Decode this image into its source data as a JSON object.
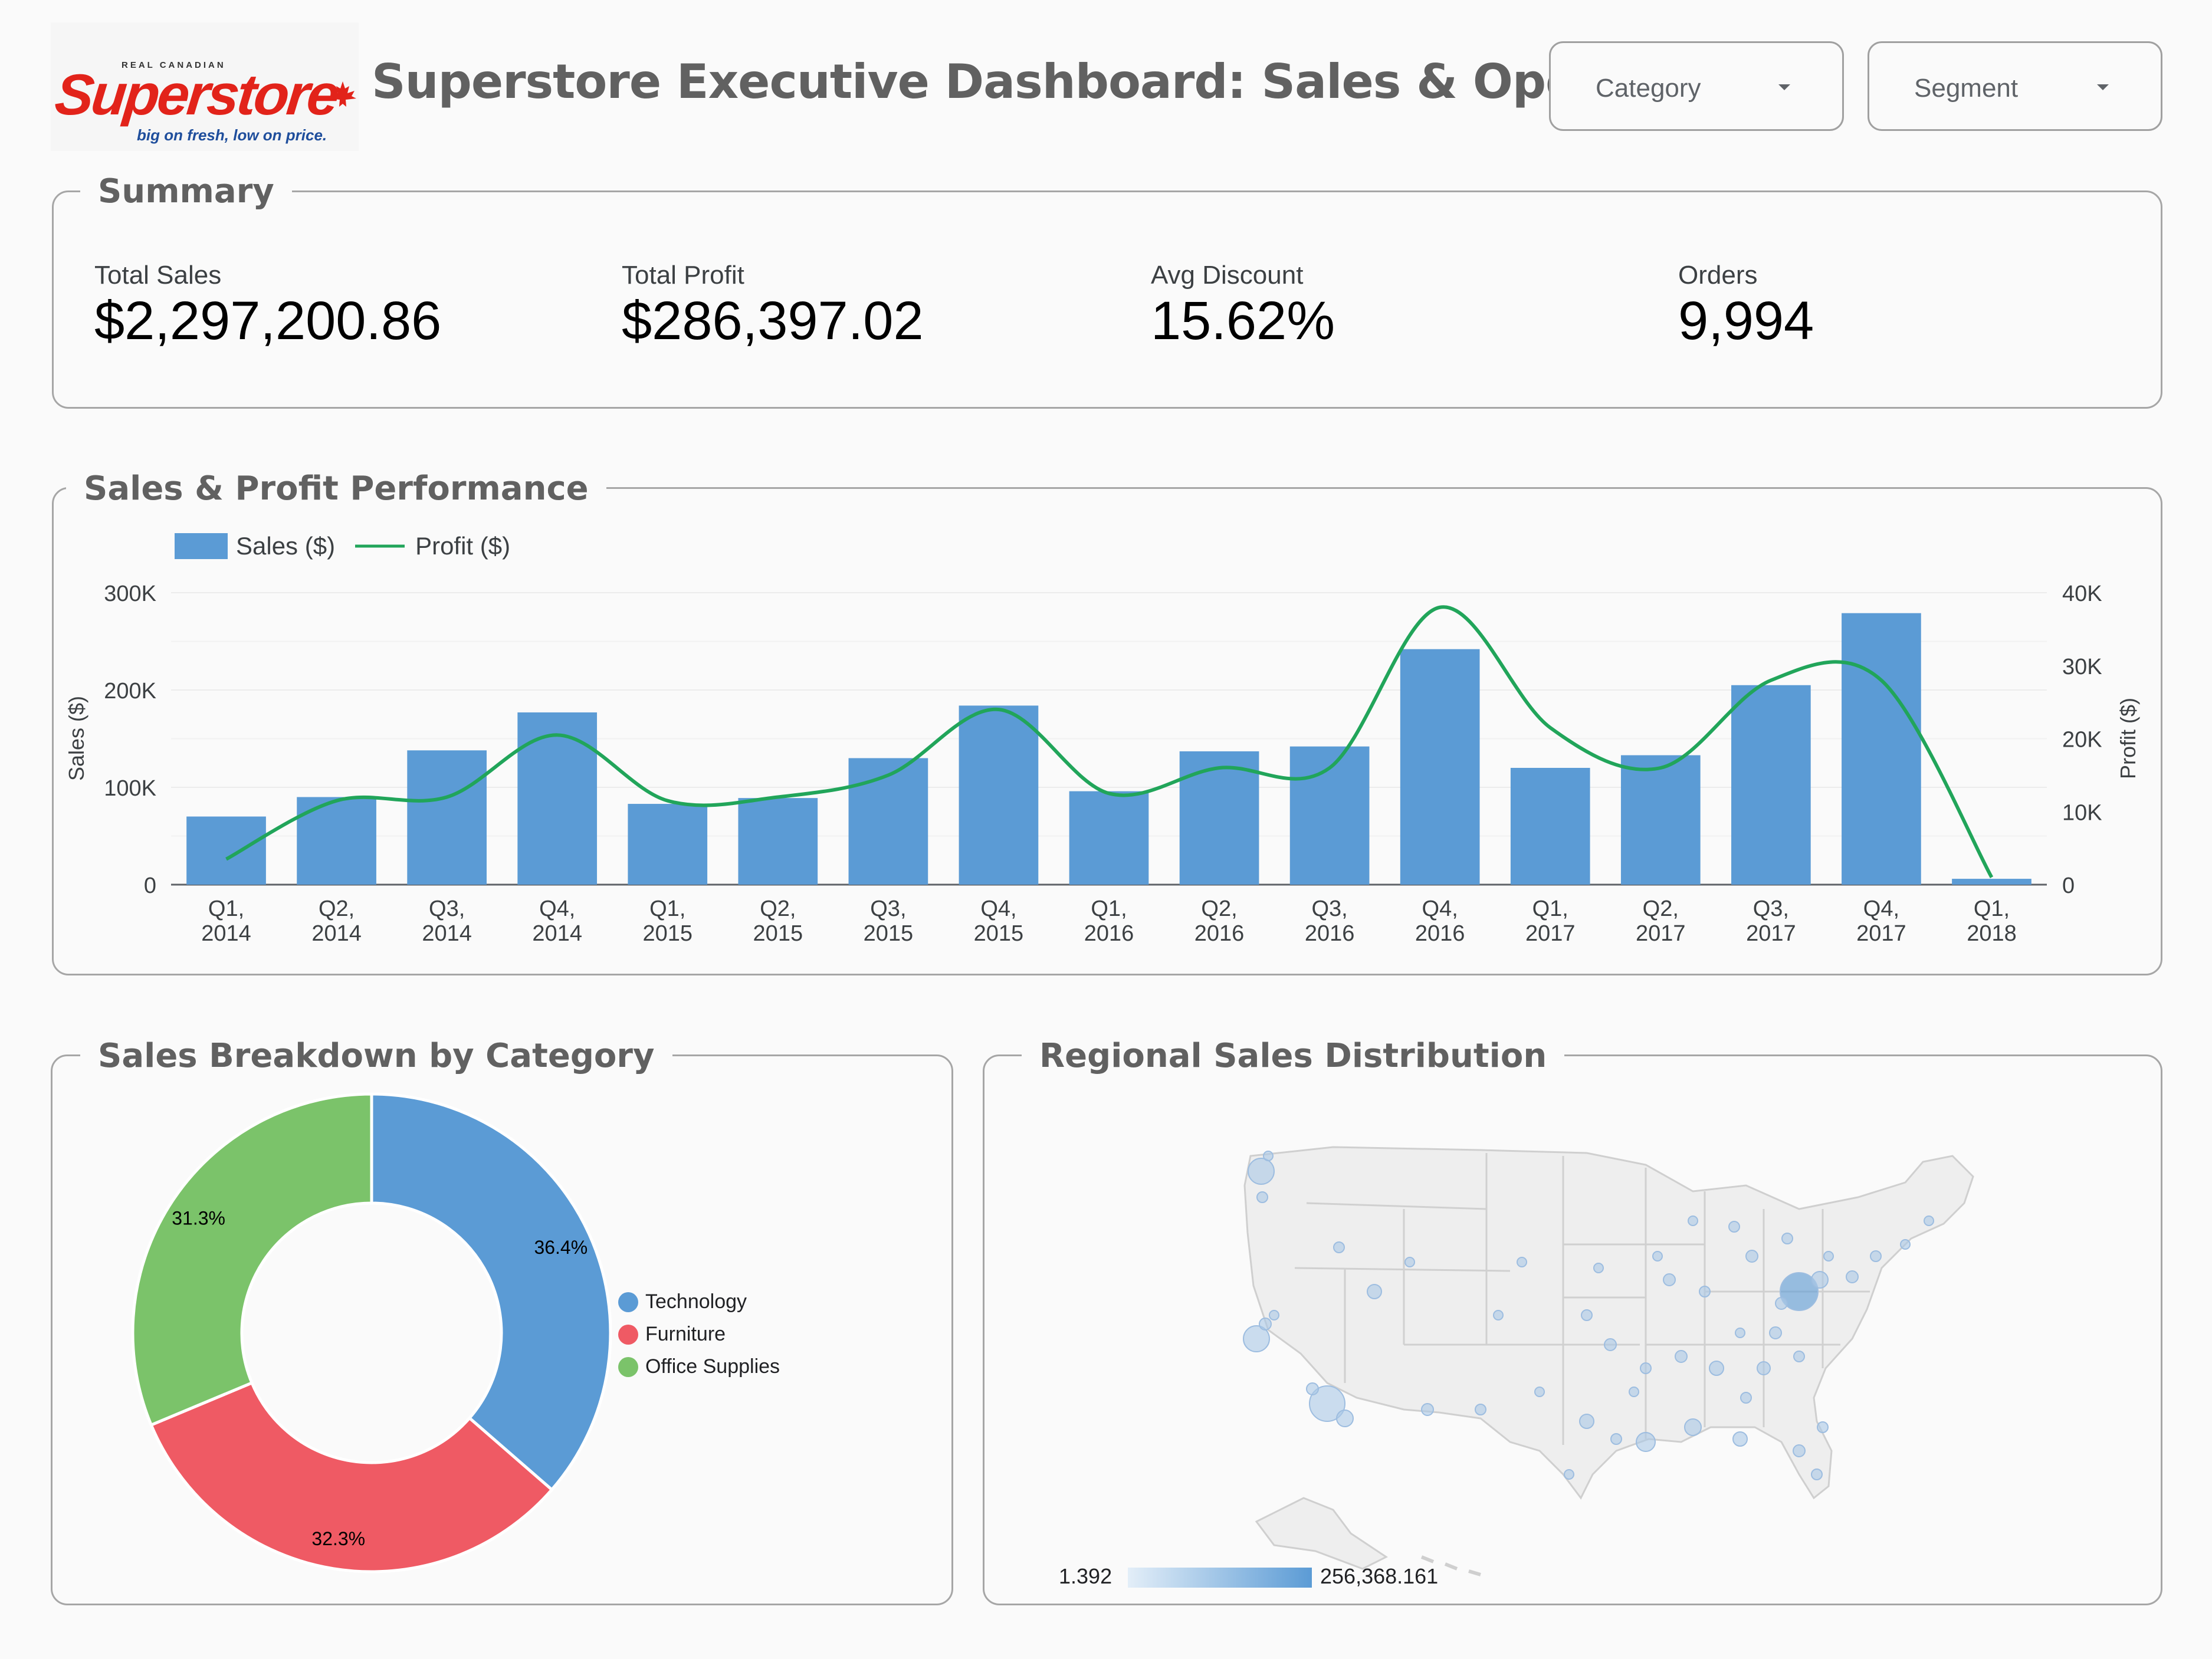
{
  "header": {
    "logo": {
      "top_text": "REAL CANADIAN",
      "brand": "Superstore",
      "tagline": "big on fresh, low on price."
    },
    "title": "Superstore Executive Dashboard: Sales & Operations",
    "filters": [
      {
        "label": "Category",
        "icon": "dropdown-caret-icon"
      },
      {
        "label": "Segment",
        "icon": "dropdown-caret-icon"
      }
    ]
  },
  "summary": {
    "title": "Summary",
    "kpis": [
      {
        "label": "Total Sales",
        "value": "$2,297,200.86"
      },
      {
        "label": "Total Profit",
        "value": "$286,397.02"
      },
      {
        "label": "Avg Discount",
        "value": "15.62%"
      },
      {
        "label": "Orders",
        "value": "9,994"
      }
    ]
  },
  "performance": {
    "title": "Sales & Profit Performance",
    "legend": {
      "sales": "Sales ($)",
      "profit": "Profit ($)"
    }
  },
  "category": {
    "title": "Sales Breakdown by Category"
  },
  "regional": {
    "title": "Regional Sales Distribution",
    "scale_min": "1.392",
    "scale_max": "256,368.161"
  },
  "colors": {
    "bar": "#5b9bd5",
    "profit_line": "#21a55a",
    "technology": "#5b9bd5",
    "furniture": "#ef5a64",
    "office_supplies": "#7bc36a",
    "map_land": "#eeeeee",
    "map_border": "#c8c8c8",
    "bubble": "#aac8e6"
  },
  "chart_data": [
    {
      "type": "bar",
      "title": "Sales & Profit Performance",
      "categories": [
        "Q1,\n2014",
        "Q2,\n2014",
        "Q3,\n2014",
        "Q4,\n2014",
        "Q1,\n2015",
        "Q2,\n2015",
        "Q3,\n2015",
        "Q4,\n2015",
        "Q1,\n2016",
        "Q2,\n2016",
        "Q3,\n2016",
        "Q4,\n2016",
        "Q1,\n2017",
        "Q2,\n2017",
        "Q3,\n2017",
        "Q4,\n2017",
        "Q1,\n2018"
      ],
      "series": [
        {
          "name": "Sales ($)",
          "type": "bar",
          "axis": "left",
          "values": [
            70000,
            90000,
            138000,
            177000,
            83000,
            89000,
            130000,
            184000,
            96000,
            137000,
            142000,
            242000,
            120000,
            133000,
            205000,
            279000,
            6000
          ]
        },
        {
          "name": "Profit ($)",
          "type": "line",
          "axis": "right",
          "values": [
            3500,
            11500,
            12000,
            20500,
            11500,
            12000,
            15000,
            24000,
            12500,
            16000,
            16000,
            38000,
            21500,
            16000,
            28000,
            28000,
            1000
          ]
        }
      ],
      "ylabel": "Sales ($)",
      "y2label": "Profit ($)",
      "ylim": [
        0,
        300000
      ],
      "y2lim": [
        0,
        40000
      ],
      "yticks": [
        "0",
        "100K",
        "200K",
        "300K"
      ],
      "y2ticks": [
        "0",
        "10K",
        "20K",
        "30K",
        "40K"
      ],
      "legend": "top-left",
      "grid": true
    },
    {
      "type": "pie",
      "title": "Sales Breakdown by Category",
      "donut": true,
      "slices": [
        {
          "label": "Technology",
          "value": 36.4,
          "display": "36.4%"
        },
        {
          "label": "Furniture",
          "value": 32.3,
          "display": "32.3%"
        },
        {
          "label": "Office Supplies",
          "value": 31.3,
          "display": "31.3%"
        }
      ],
      "legend": "right"
    }
  ]
}
